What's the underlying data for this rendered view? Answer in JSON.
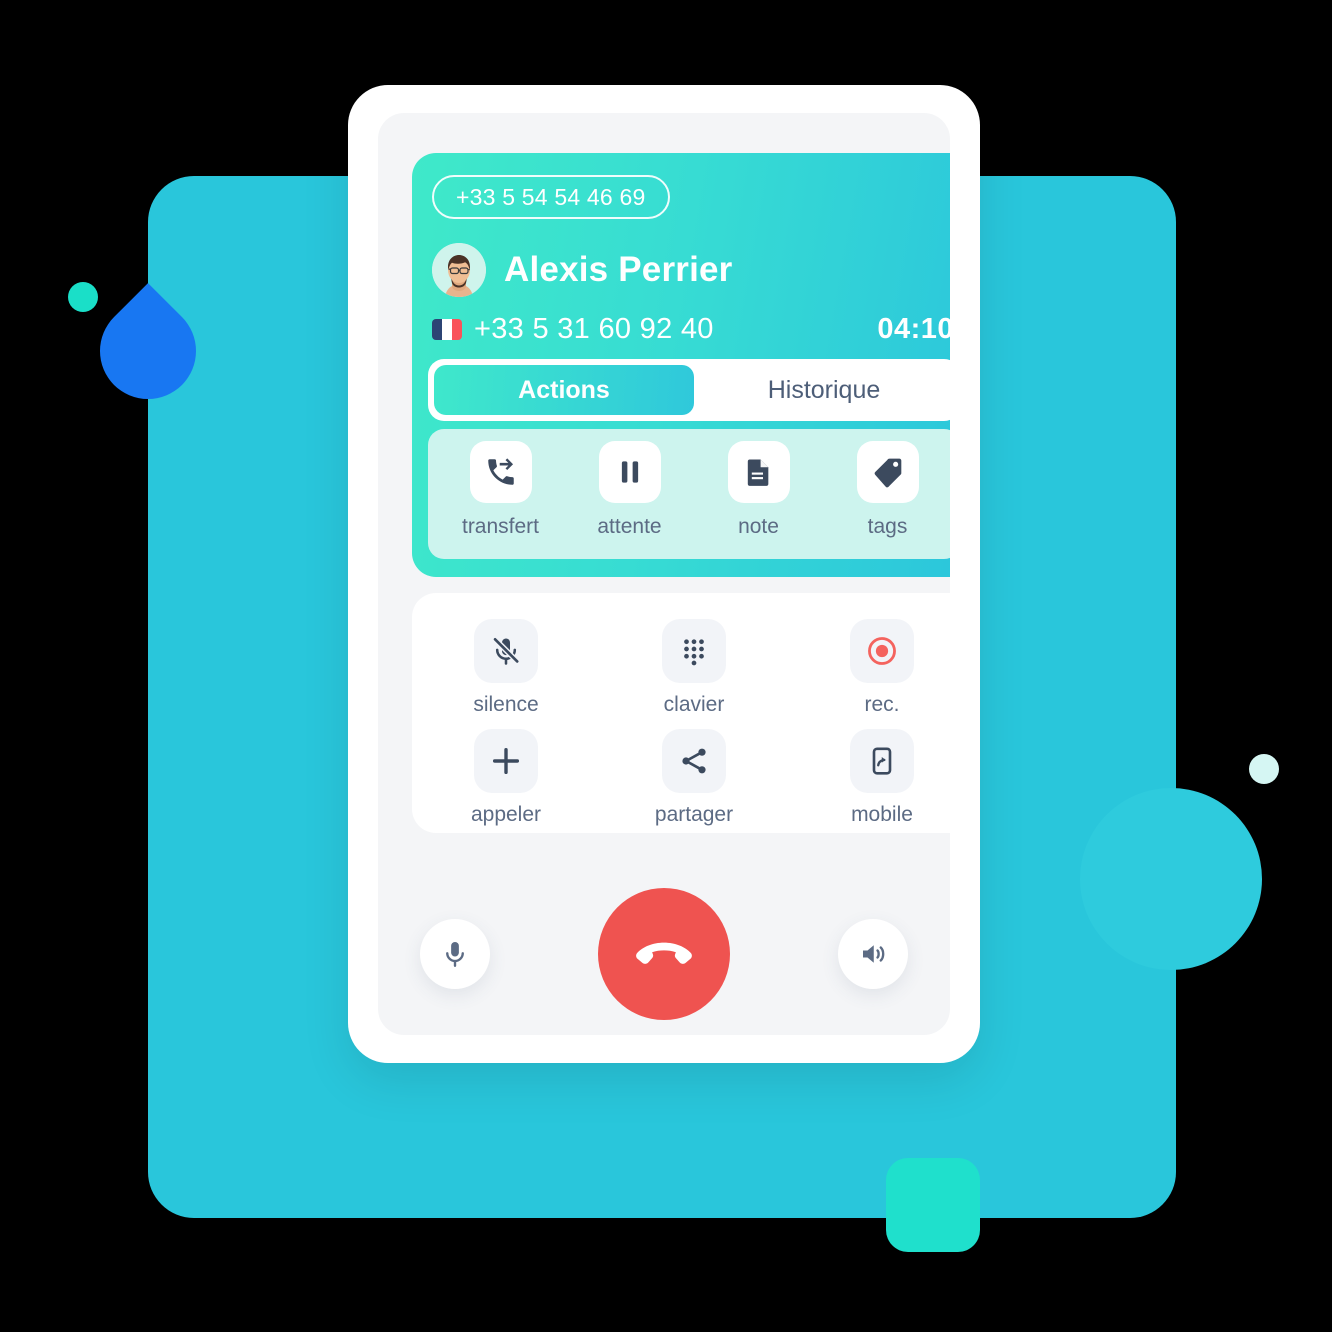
{
  "background": {
    "page_color": "#000000",
    "panel_color": "#29C6DB",
    "circle_color": "#2ECBDD",
    "mint_dot_color": "#1ADFC8",
    "pale_dot_color": "#D5F6F3",
    "leaf_color": "#1877F2",
    "square_color": "#1FE0CC"
  },
  "header": {
    "line_pill": "+33 5 54 54 46 69",
    "contact_name": "Alexis Perrier",
    "contact_number": "+33 5 31 60 92 40",
    "country_flag": "france-flag",
    "call_duration": "04:10",
    "gradient_from": "#3FE9C9",
    "gradient_to": "#2BC5DC"
  },
  "tabs": [
    {
      "label": "Actions",
      "active": true
    },
    {
      "label": "Historique",
      "active": false
    }
  ],
  "actions": [
    {
      "label": "transfert",
      "icon": "phone-forward-icon"
    },
    {
      "label": "attente",
      "icon": "pause-icon"
    },
    {
      "label": "note",
      "icon": "document-icon"
    },
    {
      "label": "tags",
      "icon": "tag-icon"
    }
  ],
  "controls": [
    {
      "label": "silence",
      "icon": "mic-off-icon",
      "color": "#3C4A5E"
    },
    {
      "label": "clavier",
      "icon": "dialpad-icon",
      "color": "#3C4A5E"
    },
    {
      "label": "rec.",
      "icon": "record-icon",
      "color": "#F4635E"
    },
    {
      "label": "appeler",
      "icon": "plus-icon",
      "color": "#3C4A5E"
    },
    {
      "label": "partager",
      "icon": "share-icon",
      "color": "#3C4A5E"
    },
    {
      "label": "mobile",
      "icon": "mobile-transfer-icon",
      "color": "#3C4A5E"
    }
  ],
  "callbar": {
    "mic_icon": "microphone-icon",
    "hangup_icon": "hangup-phone-icon",
    "speaker_icon": "speaker-icon",
    "hangup_color": "#EF5350"
  }
}
